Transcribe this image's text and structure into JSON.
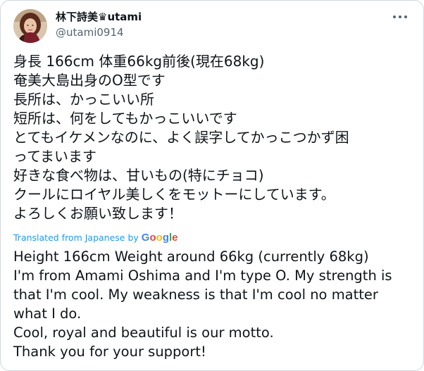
{
  "author": {
    "display_name": "林下詩美♛utami",
    "handle": "@utami0914"
  },
  "tweet": {
    "original_lines": [
      "身長 166cm 体重66kg前後(現在68kg)",
      "奄美大島出身のO型です",
      "長所は、かっこいい所",
      "短所は、何をしてもかっこいいです",
      "とてもイケメンなのに、よく誤字してかっこつかず困",
      "ってまいます",
      "好きな食べ物は、甘いもの(特にチョコ)",
      "クールにロイヤル美しくをモットーにしています。",
      "よろしくお願い致します！"
    ],
    "translated_from_label": "Translated from Japanese by",
    "translator_brand": "Google",
    "translation_lines": [
      "Height 166cm Weight around 66kg (currently 68kg)",
      "I'm from Amami Oshima and I'm type O. My strength is",
      "that I'm cool. My weakness is that I'm cool no matter",
      "what I do.",
      "Cool, royal and beautiful is our motto.",
      "Thank you for your support!"
    ]
  },
  "icons": {
    "more": "more-dots-icon",
    "avatar": "avatar-photo"
  },
  "colors": {
    "text_primary": "#0f1419",
    "text_secondary": "#536471",
    "accent": "#1d9bf0",
    "border": "#cfd9de",
    "google_blue": "#4285f4",
    "google_red": "#ea4335",
    "google_yellow": "#fbbc05",
    "google_green": "#34a853"
  }
}
